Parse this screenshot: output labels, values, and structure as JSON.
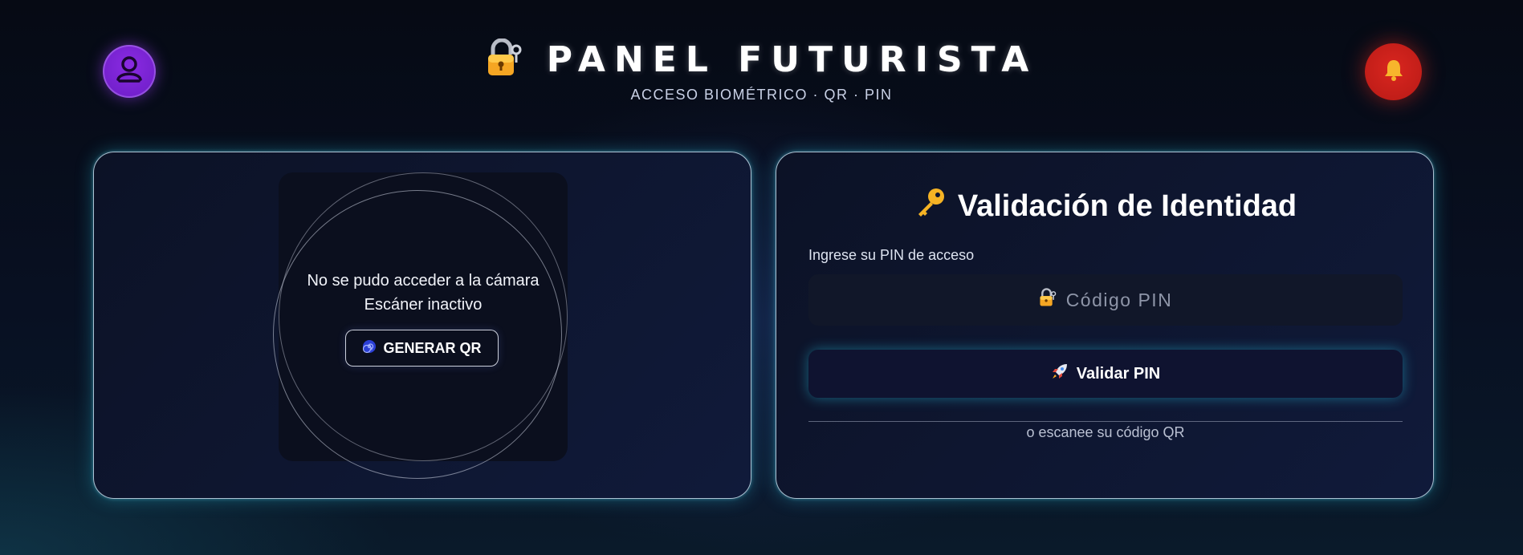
{
  "header": {
    "title": "PANEL FUTURISTA",
    "subtitle": "ACCESO BIOMÉTRICO · QR · PIN",
    "title_icon": "lock-key-icon",
    "user_icon": "user-icon",
    "notification_icon": "bell-icon"
  },
  "scanner": {
    "message_line1": "No se pudo acceder a la cámara",
    "message_line2": "Escáner inactivo",
    "generate_qr_label": "GENERAR QR",
    "generate_qr_icon": "spiral-icon"
  },
  "validation": {
    "title": "Validación de Identidad",
    "title_icon": "key-icon",
    "pin_label": "Ingrese su PIN de acceso",
    "pin_placeholder": "Código PIN",
    "pin_value": "",
    "pin_icon": "lock-key-icon",
    "validate_label": "Validar PIN",
    "validate_icon": "rocket-icon",
    "alt_text": "o escanee su código QR"
  },
  "colors": {
    "accent_glow": "#28c8e6",
    "avatar": "#8a2be2",
    "bell": "#d9261f",
    "panel_bg": "#0c1226"
  }
}
